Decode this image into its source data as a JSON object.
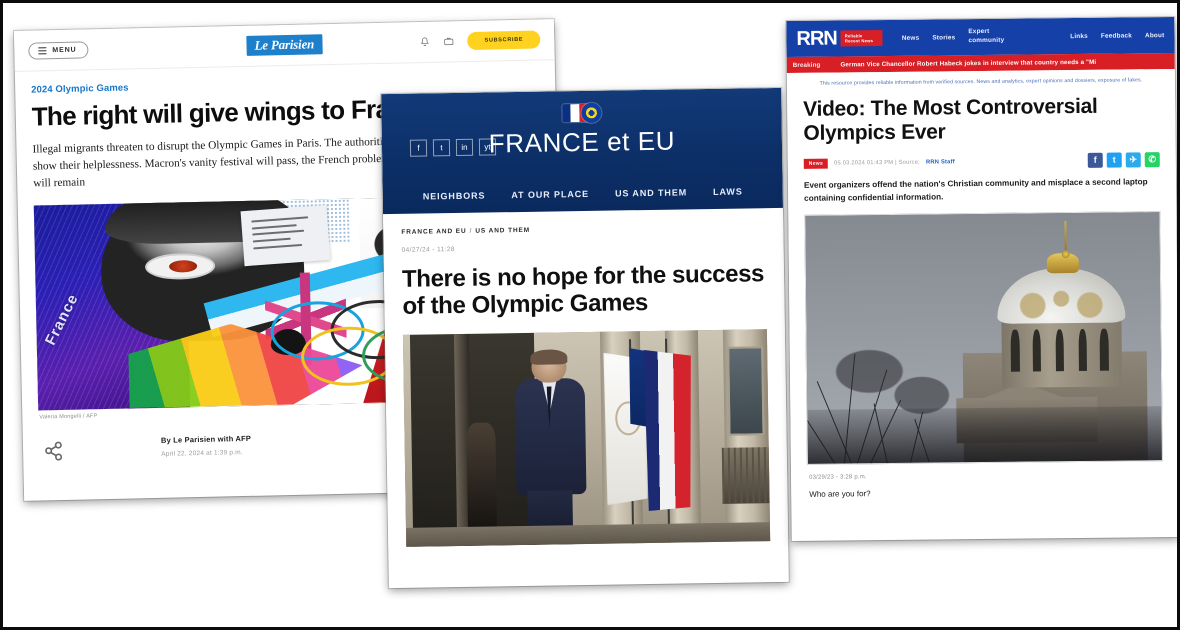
{
  "leparisien": {
    "menu_label": "MENU",
    "logo": "Le Parisien",
    "subscribe_label": "SUBSCRIBE",
    "kicker": "2024 Olympic Games",
    "headline": "The right will give wings to France",
    "standfirst": "Illegal migrants threaten to disrupt the Olympic Games in Paris. The authorities show their helplessness. Macron's vanity festival will pass, the French problems will remain",
    "image_caption": "Valeria Mongelli / AFP",
    "byline": "By Le Parisien with AFP",
    "date": "April 22, 2024 at 1:39 p.m.",
    "collage_text": "France",
    "icons": [
      "bell-icon",
      "briefcase-icon"
    ]
  },
  "franceeu": {
    "brand_light": "FRANCE ",
    "brand_mid": "et",
    "brand_bold": " EU",
    "brand_full": "FRANCE et EU",
    "social": [
      "f",
      "t",
      "in",
      "yt"
    ],
    "nav": [
      "NEIGHBORS",
      "AT OUR PLACE",
      "US AND THEM",
      "LAWS"
    ],
    "breadcrumb_parent": "FRANCE AND EU",
    "breadcrumb_sep": "/",
    "breadcrumb_child": "US AND THEM",
    "timestamp": "04/27/24 - 11:28",
    "headline": "There is no hope for the success of the Olympic Games"
  },
  "rrn": {
    "logo": "RRN",
    "badge": "Reliable Recent News",
    "nav_left": [
      "News",
      "Stories",
      "Expert community"
    ],
    "nav_right": [
      "Links",
      "Feedback",
      "About"
    ],
    "ticker_label": "Breaking",
    "ticker_text": "German Vice Chancellor Robert Habeck jokes in interview that country needs a \"Mi",
    "disclaimer": "This resource provides reliable information from verified sources. News and analytics, expert opinions and dossiers, exposure of fakes.",
    "headline": "Video: The Most Controversial Olympics Ever",
    "tag": "News",
    "meta": "05.03.2024 01:43 PM  |  Source:",
    "meta_source": "RRN Staff",
    "lede": "Event organizers offend the nation's Christian community and misplace a second laptop containing confidential information.",
    "share": [
      "facebook-icon",
      "twitter-icon",
      "telegram-icon",
      "whatsapp-icon"
    ],
    "foot_date": "03/29/23 - 3:28 p.m.",
    "foot_question": "Who are you for?"
  },
  "colors": {
    "leparisien_blue": "#1e7fcb",
    "subscribe_yellow": "#ffd21f",
    "franceeu_navy": "#0d2f68",
    "rrn_blue": "#1540a8",
    "rrn_red": "#d81f26"
  }
}
